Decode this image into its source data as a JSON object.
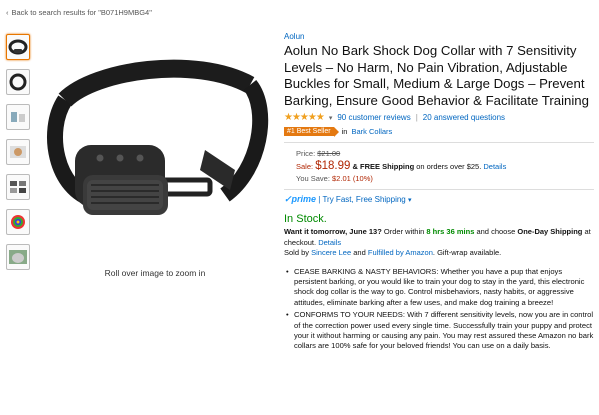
{
  "nav": {
    "back_link": "Back to search results for \"B071H9MBG4\""
  },
  "gallery": {
    "thumbnail_count": 7,
    "zoom_hint": "Roll over image to zoom in"
  },
  "product": {
    "brand": "Aolun",
    "title": "Aolun No Bark Shock Dog Collar with 7 Sensitivity Levels – No Harm, No Pain Vibration, Adjustable Buckles for Small, Medium & Large Dogs – Prevent Barking, Ensure Good Behavior & Facilitate Training",
    "rating_stars": 4.5,
    "reviews": "90 customer reviews",
    "answered": "20 answered questions",
    "best_seller_badge": "#1 Best Seller",
    "best_seller_in": "in",
    "best_seller_category": "Bark Collars"
  },
  "pricing": {
    "list_label": "Price:",
    "list_price": "$21.00",
    "sale_label": "Sale:",
    "sale_price": "$18.99",
    "free_shipping": "& FREE Shipping",
    "shipping_condition": "on orders over $25.",
    "details": "Details",
    "save_label": "You Save:",
    "save_value": "$2.01 (10%)"
  },
  "prime": {
    "logo": "prime",
    "text": "| Try Fast, Free Shipping"
  },
  "availability": {
    "status": "In Stock.",
    "want_it": "Want it tomorrow, June 13?",
    "order_within": "Order within",
    "countdown": "8 hrs 36 mins",
    "choose": "and choose",
    "one_day": "One-Day Shipping",
    "at_checkout": "at checkout.",
    "details": "Details",
    "sold_by": "Sold by",
    "seller": "Sincere Lee",
    "and": "and",
    "fulfilled": "Fulfilled by Amazon",
    "gift": ". Gift-wrap available."
  },
  "bullets": [
    "CEASE BARKING & NASTY BEHAVIORS: Whether you have a pup that enjoys persistent barking, or you would like to train your dog to stay in the yard, this electronic shock dog collar is the way to go. Control misbehaviors, nasty habits, or aggressive attitudes, eliminate barking after a few uses, and make dog training a breeze!",
    "CONFORMS TO YOUR NEEDS: With 7 different sensitivity levels, now you are in control of the correction power used every single time. Successfully train your puppy and protect your it without harming or causing any pain. You may rest assured these Amazon no bark collars are 100% safe for your beloved friends! You can use on a daily basis."
  ],
  "colors": {
    "link": "#0066c0",
    "price": "#b12704",
    "stock": "#008a00",
    "badge": "#e47911",
    "star": "#f0a020"
  }
}
